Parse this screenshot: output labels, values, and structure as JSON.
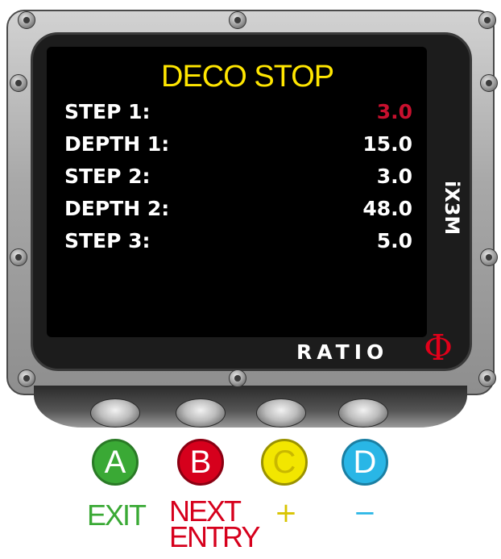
{
  "screen": {
    "title": "DECO STOP",
    "rows": [
      {
        "label": "STEP 1:",
        "value": "3.0",
        "selected": true
      },
      {
        "label": "DEPTH 1:",
        "value": "15.0",
        "selected": false
      },
      {
        "label": "STEP 2:",
        "value": "3.0",
        "selected": false
      },
      {
        "label": "DEPTH 2:",
        "value": "48.0",
        "selected": false
      },
      {
        "label": "STEP 3:",
        "value": "5.0",
        "selected": false
      }
    ]
  },
  "device": {
    "model": "iX3M",
    "brand": "RATIO",
    "logo_glyph": "Φ"
  },
  "buttons": [
    {
      "key": "A",
      "color": "#3aa935",
      "action": "EXIT"
    },
    {
      "key": "B",
      "color": "#d6001c",
      "action_line1": "NEXT",
      "action_line2": "ENTRY"
    },
    {
      "key": "C",
      "color": "#f2e600",
      "action": "+"
    },
    {
      "key": "D",
      "color": "#29b6e6",
      "action": "−"
    }
  ],
  "colors": {
    "title": "#ffe600",
    "selected_value": "#c8102e",
    "text": "#ffffff"
  }
}
